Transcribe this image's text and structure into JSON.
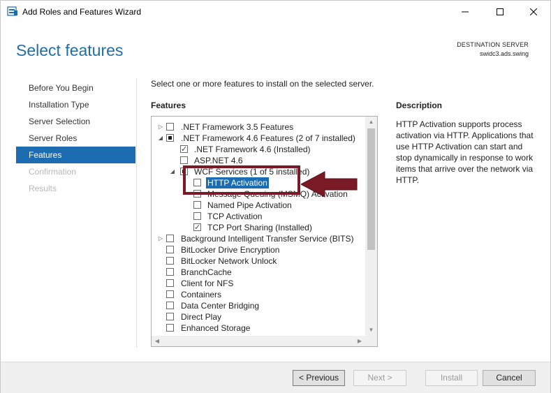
{
  "window": {
    "title": "Add Roles and Features Wizard",
    "minimize": "—",
    "maximize": "☐",
    "close": "✕"
  },
  "header": {
    "page_title": "Select features",
    "destination_label": "DESTINATION SERVER",
    "destination_value": "swidc3.ads.swing"
  },
  "nav": {
    "items": [
      {
        "label": "Before You Begin",
        "state": "normal"
      },
      {
        "label": "Installation Type",
        "state": "normal"
      },
      {
        "label": "Server Selection",
        "state": "normal"
      },
      {
        "label": "Server Roles",
        "state": "normal"
      },
      {
        "label": "Features",
        "state": "active"
      },
      {
        "label": "Confirmation",
        "state": "disabled"
      },
      {
        "label": "Results",
        "state": "disabled"
      }
    ]
  },
  "content": {
    "instruction": "Select one or more features to install on the selected server.",
    "features_label": "Features",
    "description_label": "Description",
    "description_text": "HTTP Activation supports process activation via HTTP. Applications that use HTTP Activation can start and stop dynamically in response to work items that arrive over the network via HTTP."
  },
  "features": [
    {
      "label": ".NET Framework 3.5 Features",
      "level": 0,
      "expander": "collapsed",
      "state": "unchecked"
    },
    {
      "label": ".NET Framework 4.6 Features (2 of 7 installed)",
      "level": 0,
      "expander": "expanded",
      "state": "indeterminate"
    },
    {
      "label": ".NET Framework 4.6 (Installed)",
      "level": 1,
      "expander": "none",
      "state": "checked"
    },
    {
      "label": "ASP.NET 4.6",
      "level": 1,
      "expander": "none",
      "state": "unchecked"
    },
    {
      "label": "WCF Services (1 of 5 installed)",
      "level": 1,
      "expander": "expanded",
      "state": "indeterminate"
    },
    {
      "label": "HTTP Activation",
      "level": 2,
      "expander": "none",
      "state": "unchecked",
      "selected": true
    },
    {
      "label": "Message Queuing (MSMQ) Activation",
      "level": 2,
      "expander": "none",
      "state": "unchecked"
    },
    {
      "label": "Named Pipe Activation",
      "level": 2,
      "expander": "none",
      "state": "unchecked"
    },
    {
      "label": "TCP Activation",
      "level": 2,
      "expander": "none",
      "state": "unchecked"
    },
    {
      "label": "TCP Port Sharing (Installed)",
      "level": 2,
      "expander": "none",
      "state": "checked"
    },
    {
      "label": "Background Intelligent Transfer Service (BITS)",
      "level": 0,
      "expander": "collapsed",
      "state": "unchecked"
    },
    {
      "label": "BitLocker Drive Encryption",
      "level": 0,
      "expander": "none",
      "state": "unchecked"
    },
    {
      "label": "BitLocker Network Unlock",
      "level": 0,
      "expander": "none",
      "state": "unchecked"
    },
    {
      "label": "BranchCache",
      "level": 0,
      "expander": "none",
      "state": "unchecked"
    },
    {
      "label": "Client for NFS",
      "level": 0,
      "expander": "none",
      "state": "unchecked"
    },
    {
      "label": "Containers",
      "level": 0,
      "expander": "none",
      "state": "unchecked"
    },
    {
      "label": "Data Center Bridging",
      "level": 0,
      "expander": "none",
      "state": "unchecked"
    },
    {
      "label": "Direct Play",
      "level": 0,
      "expander": "none",
      "state": "unchecked"
    },
    {
      "label": "Enhanced Storage",
      "level": 0,
      "expander": "none",
      "state": "unchecked"
    }
  ],
  "footer": {
    "previous": "< Previous",
    "next": "Next >",
    "install": "Install",
    "cancel": "Cancel"
  },
  "colors": {
    "accent": "#1b6cb0",
    "title_blue": "#1e6fa9",
    "annotation": "#7a1a26"
  }
}
